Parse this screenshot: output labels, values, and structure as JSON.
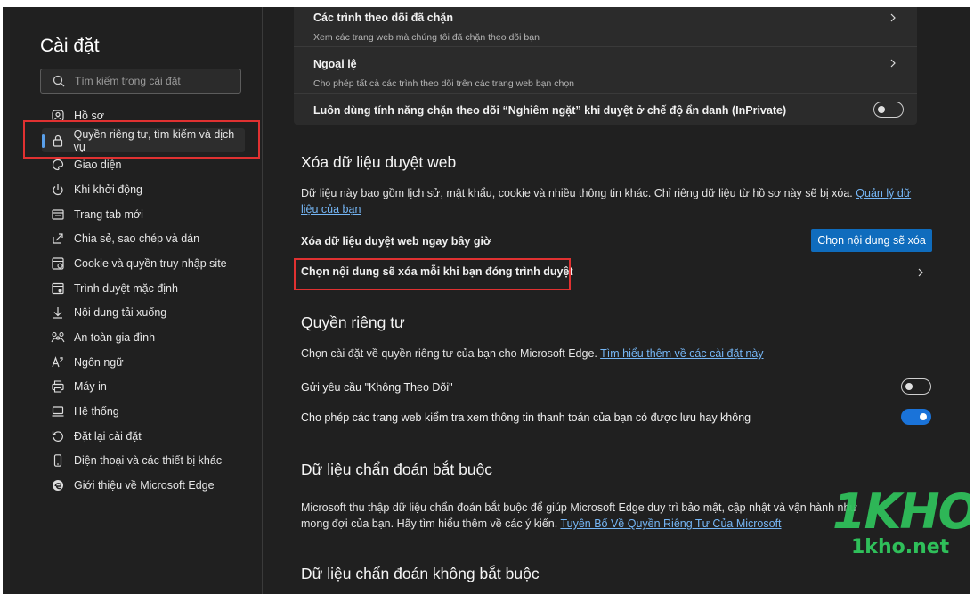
{
  "sidebar": {
    "title": "Cài đặt",
    "search_placeholder": "Tìm kiếm trong cài đặt",
    "items": [
      {
        "label": "Hồ sơ",
        "icon": "profile-icon"
      },
      {
        "label": "Quyền riêng tư, tìm kiếm và dịch vụ",
        "icon": "lock-icon",
        "active": true
      },
      {
        "label": "Giao diện",
        "icon": "appearance-icon"
      },
      {
        "label": "Khi khởi động",
        "icon": "power-icon"
      },
      {
        "label": "Trang tab mới",
        "icon": "new-tab-icon"
      },
      {
        "label": "Chia sẻ, sao chép và dán",
        "icon": "share-icon"
      },
      {
        "label": "Cookie và quyền truy nhập site",
        "icon": "cookie-icon"
      },
      {
        "label": "Trình duyệt mặc định",
        "icon": "browser-icon"
      },
      {
        "label": "Nội dung tải xuống",
        "icon": "download-icon"
      },
      {
        "label": "An toàn gia đình",
        "icon": "family-icon"
      },
      {
        "label": "Ngôn ngữ",
        "icon": "language-icon"
      },
      {
        "label": "Máy in",
        "icon": "printer-icon"
      },
      {
        "label": "Hệ thống",
        "icon": "system-icon"
      },
      {
        "label": "Đặt lại cài đặt",
        "icon": "reset-icon"
      },
      {
        "label": "Điện thoại và các thiết bị khác",
        "icon": "phone-icon"
      },
      {
        "label": "Giới thiệu về Microsoft Edge",
        "icon": "edge-icon"
      }
    ]
  },
  "tracking": {
    "blocked_title": "Các trình theo dõi đã chặn",
    "blocked_sub": "Xem các trang web mà chúng tôi đã chặn theo dõi bạn",
    "exceptions_title": "Ngoại lệ",
    "exceptions_sub": "Cho phép tất cả các trình theo dõi trên các trang web bạn chọn",
    "strict_label": "Luôn dùng tính năng chặn theo dõi “Nghiêm ngặt” khi duyệt ở chế độ ẩn danh (InPrivate)"
  },
  "clear_data": {
    "heading": "Xóa dữ liệu duyệt web",
    "desc": "Dữ liệu này bao gồm lịch sử, mật khẩu, cookie và nhiều thông tin khác. Chỉ riêng dữ liệu từ hồ sơ này sẽ bị xóa.",
    "desc_link": "Quản lý dữ liệu của bạn",
    "now_label": "Xóa dữ liệu duyệt web ngay bây giờ",
    "now_button": "Chọn nội dung sẽ xóa",
    "on_close_label": "Chọn nội dung sẽ xóa mỗi khi bạn đóng trình duyệt"
  },
  "privacy": {
    "heading": "Quyền riêng tư",
    "desc": "Chọn cài đặt về quyền riêng tư của bạn cho Microsoft Edge.",
    "desc_link": "Tìm hiểu thêm về các cài đặt này",
    "dnt_label": "Gửi yêu cầu \"Không Theo Dõi\"",
    "payment_label": "Cho phép các trang web kiểm tra xem thông tin thanh toán của bạn có được lưu hay không"
  },
  "toggles": {
    "strict_inprivate": false,
    "do_not_track": false,
    "payment_check": true
  },
  "diag_required": {
    "heading": "Dữ liệu chẩn đoán bắt buộc",
    "desc": "Microsoft thu thập dữ liệu chẩn đoán bắt buộc để giúp Microsoft Edge duy trì bảo mật, cập nhật và vận hành như mong đợi của bạn. Hãy tìm hiểu thêm về các ý kiến.",
    "desc_link": "Tuyên Bố Về Quyền Riêng Tư Của Microsoft"
  },
  "diag_optional": {
    "heading": "Dữ liệu chẩn đoán không bắt buộc"
  },
  "watermark": {
    "logo": "1KHO",
    "url": "1kho.net"
  },
  "colors": {
    "accent": "#0f6cbd",
    "highlight_box": "#e03131",
    "watermark": "#2fbf5a"
  }
}
